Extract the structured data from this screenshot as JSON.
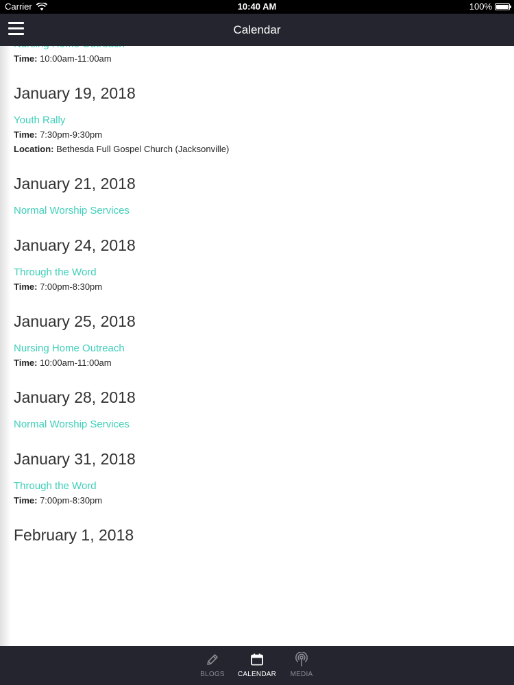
{
  "status_bar": {
    "carrier": "Carrier",
    "time": "10:40 AM",
    "battery": "100%"
  },
  "nav": {
    "title": "Calendar"
  },
  "partial_event": {
    "title": "Nursing Home Outreach",
    "time_label": "Time:",
    "time": "10:00am-11:00am"
  },
  "days": [
    {
      "date": "January 19, 2018",
      "events": [
        {
          "title": "Youth Rally",
          "time_label": "Time:",
          "time": "7:30pm-9:30pm",
          "location_label": "Location:",
          "location": "Bethesda Full Gospel Church (Jacksonville)"
        }
      ]
    },
    {
      "date": "January 21, 2018",
      "events": [
        {
          "title": "Normal Worship Services"
        }
      ]
    },
    {
      "date": "January 24, 2018",
      "events": [
        {
          "title": "Through the Word",
          "time_label": "Time:",
          "time": "7:00pm-8:30pm"
        }
      ]
    },
    {
      "date": "January 25, 2018",
      "events": [
        {
          "title": "Nursing Home Outreach",
          "time_label": "Time:",
          "time": "10:00am-11:00am"
        }
      ]
    },
    {
      "date": "January 28, 2018",
      "events": [
        {
          "title": "Normal Worship Services"
        }
      ]
    },
    {
      "date": "January 31, 2018",
      "events": [
        {
          "title": "Through the Word",
          "time_label": "Time:",
          "time": "7:00pm-8:30pm"
        }
      ]
    },
    {
      "date": "February 1, 2018",
      "events": []
    }
  ],
  "tabs": [
    {
      "label": "BLOGS",
      "icon": "pencil-icon",
      "active": false
    },
    {
      "label": "CALENDAR",
      "icon": "calendar-icon",
      "active": true
    },
    {
      "label": "MEDIA",
      "icon": "podcast-icon",
      "active": false
    }
  ],
  "colors": {
    "accent": "#3fcfb9",
    "bar_background": "#25252f",
    "tab_inactive": "#8b8b93",
    "tab_active": "#ffffff"
  }
}
